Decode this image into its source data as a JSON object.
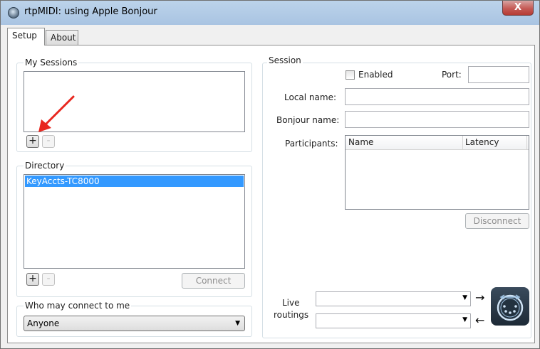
{
  "window": {
    "title": "rtpMIDI: using Apple Bonjour",
    "close_glyph": "X"
  },
  "tabs": [
    {
      "label": "Setup",
      "active": true
    },
    {
      "label": "About",
      "active": false
    }
  ],
  "my_sessions": {
    "title": "My Sessions",
    "add_label": "+",
    "remove_label": "-"
  },
  "directory": {
    "title": "Directory",
    "items": [
      "KeyAccts-TC8000"
    ],
    "add_label": "+",
    "remove_label": "-",
    "connect_label": "Connect"
  },
  "who_may_connect": {
    "title": "Who may connect to me",
    "selected": "Anyone"
  },
  "session": {
    "title": "Session",
    "enabled_label": "Enabled",
    "enabled": false,
    "port_label": "Port:",
    "local_name_label": "Local name:",
    "bonjour_name_label": "Bonjour name:",
    "participants_label": "Participants:",
    "columns": [
      "Name",
      "Latency"
    ],
    "disconnect_label": "Disconnect"
  },
  "live_routings": {
    "label_line1": "Live",
    "label_line2": "routings",
    "out_arrow": "→",
    "in_arrow": "←"
  },
  "icons": {
    "app": "rtpmidi-app-icon",
    "midi": "midi-connector-icon",
    "annotation": "red-arrow-annotation"
  },
  "colors": {
    "selection": "#3399ff",
    "annotation_red": "#e8261e",
    "titlebar": "#b3cce8"
  }
}
